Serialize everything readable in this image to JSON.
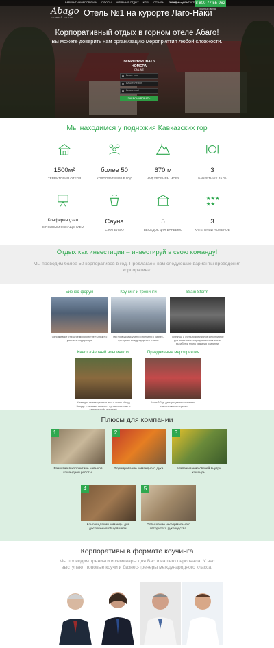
{
  "header": {
    "logo": "Abago",
    "logo_sub": "ГОРНЫЙ ОТЕЛЬ",
    "title": "Отель №1 на курорте Лаго-Наки",
    "email": "hotel@abago.ru",
    "phone": "8 800 77 55 962",
    "callback": "обратный звонок",
    "nav": [
      "варианты корпоратива",
      "плюсы",
      "активный отдых",
      "коуч",
      "отзывы",
      "тарифы",
      "контакты"
    ]
  },
  "hero": {
    "title": "Корпоративный отдых в горном отеле Абаго!",
    "subtitle": "Вы можете доверить нам организацию мероприятия любой сложности.",
    "form": {
      "title": "ЗАБРОНИРОВАТЬ НОМЕРА",
      "online": "ONLINE",
      "name_placeholder": "Ваше имя",
      "phone_placeholder": "Ваш телефон",
      "email_placeholder": "Ваш e-mail",
      "submit": "ЗАБРОНИРОВАТЬ"
    }
  },
  "location": {
    "title": "Мы находимся у подножия Кавказских гор",
    "stats": [
      {
        "icon": "hotel-building-icon",
        "value": "1500м²",
        "caption": "ТЕРРИТОРИЯ ОТЕЛЯ"
      },
      {
        "icon": "corporate-people-icon",
        "value": "более 50",
        "caption": "КОРПОРАТИВОВ В ГОД"
      },
      {
        "icon": "mountain-icon",
        "value": "670 м",
        "caption": "НАД УРОВНЕМ МОРЯ"
      },
      {
        "icon": "banquet-plate-icon",
        "value": "3",
        "caption": "БАНКЕТНЫХ ЗАЛА"
      },
      {
        "icon": "conference-board-icon",
        "value": "Конференц зал",
        "caption": "С ПОЛНЫМ ОСНАЩЕНИЕМ"
      },
      {
        "icon": "sauna-bucket-icon",
        "value": "Сауна",
        "caption": "С КУПЕЛЬЮ"
      },
      {
        "icon": "gazebo-icon",
        "value": "5",
        "caption": "БЕСЕДОК ДЛЯ БАРБЕКЮ"
      },
      {
        "icon": "stars-icon",
        "value": "3",
        "caption": "КАТЕГОРИИ НОМЕРОВ"
      }
    ]
  },
  "invest": {
    "title": "Отдых как инвестиции – инвестируй в свою команду!",
    "subtitle": "Мы проводим более 50 корпоративов в год. Предлагаем вам следующие варианты проведения корпоратива:"
  },
  "activities": [
    {
      "title": "Бизнес-форум",
      "desc": "Однодневное открытое мероприятие «Ключи» с участием модератора"
    },
    {
      "title": "Коучинг и тренинги",
      "desc": "Мы проводим коучинги и тренинги с бизнес-тренерами международного класса."
    },
    {
      "title": "Brain Storm",
      "desc": "Полезный и очень эффективное мероприятие для выявления подходов в коллективе и выработки плана развития компании"
    },
    {
      "title": "Квест «Черный альпинист»",
      "desc": "Командно-мотивационная игра в стиле «Форд Боярд» с личным, осознан.· путешественные и «алительной» историей."
    },
    {
      "title": "Праздничные мероприятия",
      "desc": "Новый Год, день рождения компании, тематические вечеринки"
    }
  ],
  "pluses": {
    "title": "Плюсы для компании",
    "items": [
      {
        "num": "1",
        "desc": "Развитие в коллективе навыков командной работы."
      },
      {
        "num": "2",
        "desc": "Формирование командного духа."
      },
      {
        "num": "3",
        "desc": "Налаживание связей внутри команды."
      },
      {
        "num": "4",
        "desc": "Консолидация команды для достижения общей цели."
      },
      {
        "num": "5",
        "desc": "Повышение неформального авторитета руководства."
      }
    ]
  },
  "coaching": {
    "title": "Корпоративы в формате коучинга",
    "subtitle": "Мы проводим тренинги и семинары для Вас и вашего персонала. У нас выступают топовые коучи и бизнес-тренеры международного класса."
  },
  "colors": {
    "accent": "#2fa84f",
    "gray_band": "#efefef",
    "green_band": "#dcefe2"
  }
}
